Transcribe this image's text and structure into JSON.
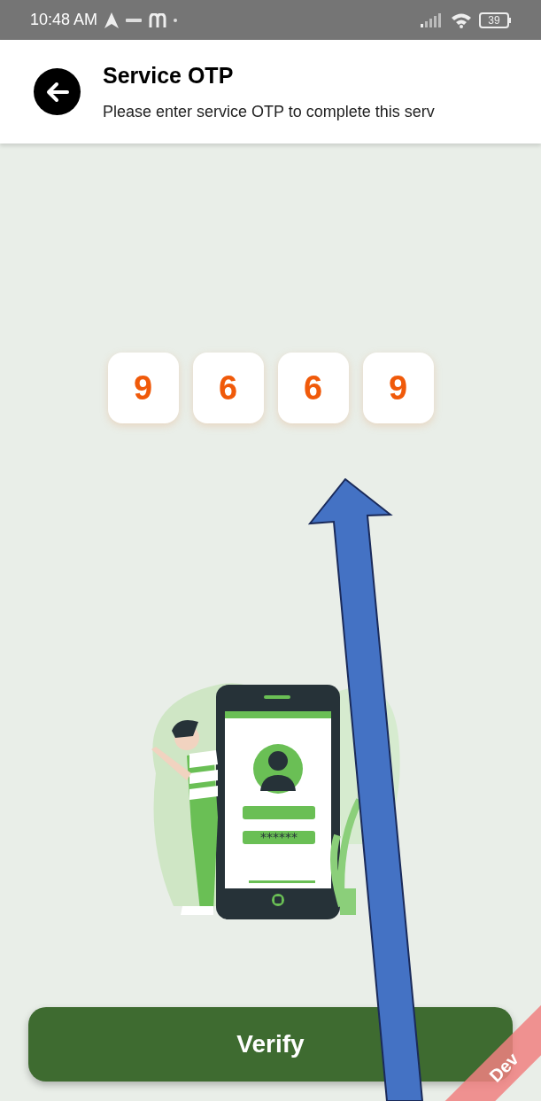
{
  "status_bar": {
    "time": "10:48 AM",
    "battery": "39"
  },
  "header": {
    "title": "Service OTP",
    "subtitle": "Please enter service OTP to complete this serv"
  },
  "otp_digits": [
    "9",
    "6",
    "6",
    "9"
  ],
  "illustration": {
    "password_mask": "******"
  },
  "verify_button": {
    "label": "Verify"
  },
  "dev_banner": {
    "label": "Dev"
  }
}
